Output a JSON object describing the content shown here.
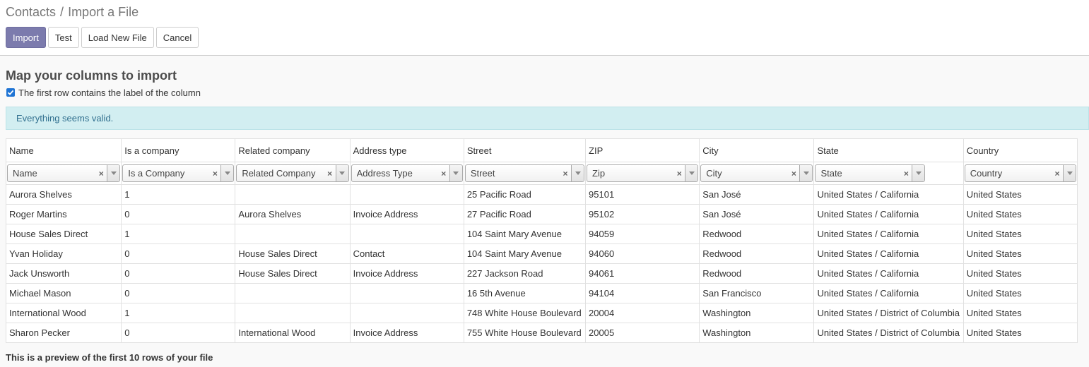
{
  "breadcrumb": {
    "parent": "Contacts",
    "separator": "/",
    "current": "Import a File"
  },
  "buttons": {
    "import": "Import",
    "test": "Test",
    "load": "Load New File",
    "cancel": "Cancel"
  },
  "heading": "Map your columns to import",
  "first_row_label": {
    "checked": true,
    "text": "The first row contains the label of the column"
  },
  "alert": "Everything seems valid.",
  "columns": [
    {
      "header": "Name",
      "field": "Name"
    },
    {
      "header": "Is a company",
      "field": "Is a Company"
    },
    {
      "header": "Related company",
      "field": "Related Company"
    },
    {
      "header": "Address type",
      "field": "Address Type"
    },
    {
      "header": "Street",
      "field": "Street"
    },
    {
      "header": "ZIP",
      "field": "Zip"
    },
    {
      "header": "City",
      "field": "City"
    },
    {
      "header": "State",
      "field": "State"
    },
    {
      "header": "Country",
      "field": "Country"
    }
  ],
  "rows": [
    [
      "Aurora Shelves",
      "1",
      "",
      "",
      "25 Pacific Road",
      "95101",
      "San José",
      "United States / California",
      "United States"
    ],
    [
      "Roger Martins",
      "0",
      "Aurora Shelves",
      "Invoice Address",
      "27 Pacific Road",
      "95102",
      "San José",
      "United States / California",
      "United States"
    ],
    [
      "House Sales Direct",
      "1",
      "",
      "",
      "104 Saint Mary Avenue",
      "94059",
      "Redwood",
      "United States / California",
      "United States"
    ],
    [
      "Yvan Holiday",
      "0",
      "House Sales Direct",
      "Contact",
      "104 Saint Mary Avenue",
      "94060",
      "Redwood",
      "United States / California",
      "United States"
    ],
    [
      "Jack Unsworth",
      "0",
      "House Sales Direct",
      "Invoice Address",
      "227 Jackson Road",
      "94061",
      "Redwood",
      "United States / California",
      "United States"
    ],
    [
      "Michael Mason",
      "0",
      "",
      "",
      "16 5th Avenue",
      "94104",
      "San Francisco",
      "United States / California",
      "United States"
    ],
    [
      "International Wood",
      "1",
      "",
      "",
      "748 White House Boulevard",
      "20004",
      "Washington",
      "United States / District of Columbia",
      "United States"
    ],
    [
      "Sharon Pecker",
      "0",
      "International Wood",
      "Invoice Address",
      "755 White House Boulevard",
      "20005",
      "Washington",
      "United States / District of Columbia",
      "United States"
    ]
  ],
  "footnote": "This is a preview of the first 10 rows of your file",
  "colors": {
    "primary": "#7c7bad",
    "alert_bg": "#d2eef1",
    "checkbox": "#1f74d4"
  }
}
